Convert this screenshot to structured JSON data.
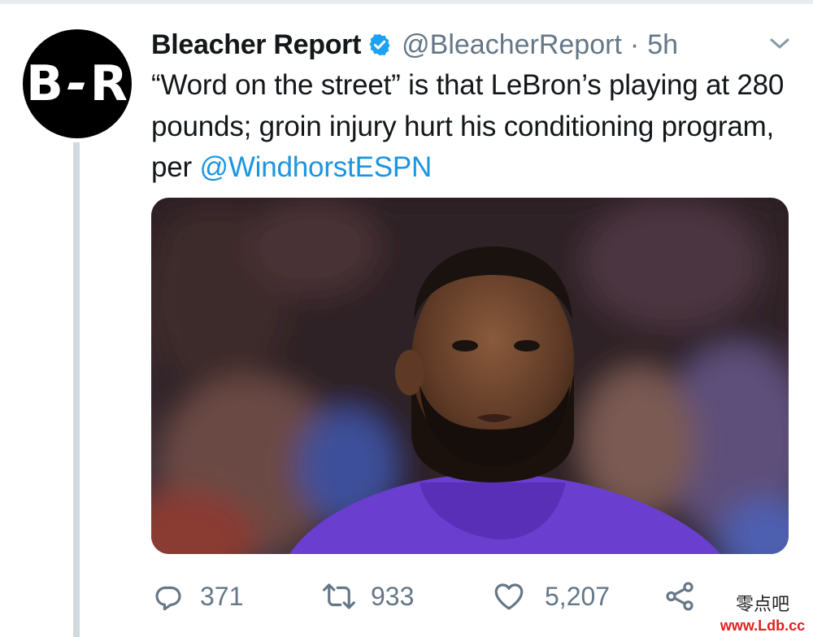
{
  "tweet": {
    "author": {
      "avatar_text": [
        "B",
        "-",
        "R"
      ],
      "display_name": "Bleacher Report",
      "handle": "@BleacherReport",
      "separator": "·",
      "time": "5h",
      "verified_color": "#1da1f2"
    },
    "text": {
      "body": "“Word on the street” is that LeBron’s playing at 280 pounds; groin injury hurt his conditioning program, per ",
      "mention": "@WindhorstESPN",
      "mention_color": "#1b95e0"
    },
    "media": {
      "icon": "photo",
      "jersey_color": "#6a3fd0"
    },
    "actions": {
      "reply": {
        "icon": "reply-icon",
        "count": "371"
      },
      "retweet": {
        "icon": "retweet-icon",
        "count": "933"
      },
      "like": {
        "icon": "heart-icon",
        "count": "5,207"
      },
      "share": {
        "icon": "share-icon"
      }
    }
  },
  "watermark": {
    "text": "零点吧",
    "url": "www.Ldb.cc"
  }
}
